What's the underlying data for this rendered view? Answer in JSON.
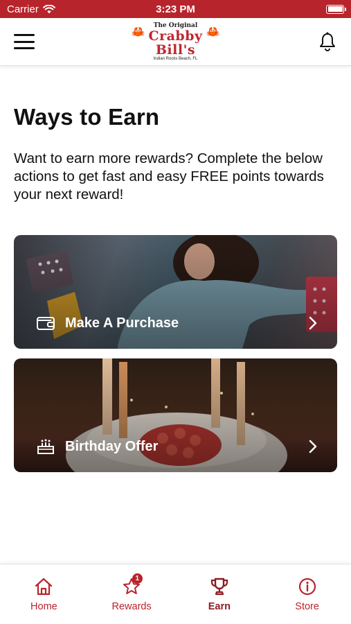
{
  "status_bar": {
    "carrier": "Carrier",
    "time": "3:23 PM"
  },
  "header": {
    "logo": {
      "line1": "The Original",
      "line2": "Crabby Bill's",
      "line3": "Indian Rocks Beach, FL"
    }
  },
  "main": {
    "title": "Ways to Earn",
    "description": "Want to earn more rewards? Complete the below actions to get fast and easy FREE points towards your next reward!",
    "cards": [
      {
        "label": "Make A Purchase",
        "icon": "wallet-icon"
      },
      {
        "label": "Birthday Offer",
        "icon": "cake-icon"
      }
    ]
  },
  "tab_bar": {
    "tabs": [
      {
        "label": "Home",
        "icon": "home-icon"
      },
      {
        "label": "Rewards",
        "icon": "star-icon",
        "badge": "1"
      },
      {
        "label": "Earn",
        "icon": "trophy-icon",
        "active": true
      },
      {
        "label": "Store",
        "icon": "info-icon"
      }
    ]
  },
  "colors": {
    "brand": "#b8242c",
    "brand_dark": "#8e1c22",
    "text": "#111111",
    "background": "#ffffff"
  }
}
